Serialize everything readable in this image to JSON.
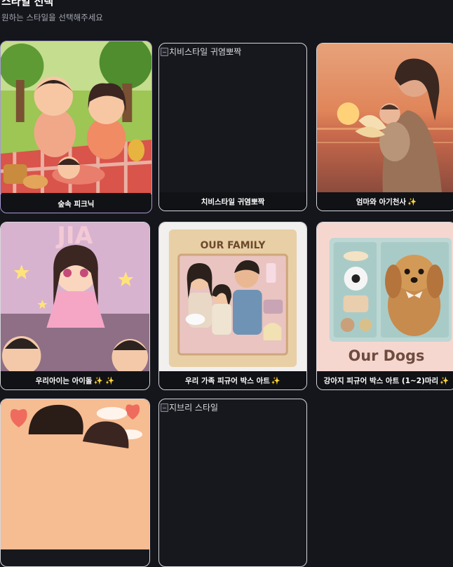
{
  "header": {
    "title": "스타일 선택",
    "subtitle": "원하는 스타일을 선택해주세요"
  },
  "cards": [
    {
      "label": "숲속 피크닉",
      "selected": true,
      "image": "forest-picnic"
    },
    {
      "label": "치비스타일 귀염뽀짝",
      "image_alt": "치비스타일 귀염뽀짝",
      "image": "broken"
    },
    {
      "label": "엄마와 아기천사",
      "sparkle": "✨",
      "image": "mother-angel"
    },
    {
      "label": "우리아이는 아이돌",
      "sparkle": "✨ ✨",
      "image": "idol",
      "image_text": "JIA"
    },
    {
      "label": "우리 가족 피규어 박스 아트",
      "sparkle": "✨",
      "image": "family-figure",
      "image_text": "OUR FAMILY"
    },
    {
      "label": "강아지 피규어 박스 아트 (1~2)마리",
      "sparkle": "✨",
      "image": "dog-figure",
      "image_text": "Our Dogs"
    },
    {
      "label": "",
      "image": "couple-partial"
    },
    {
      "label": "",
      "image_alt": "지브리 스타일",
      "image": "broken"
    }
  ]
}
